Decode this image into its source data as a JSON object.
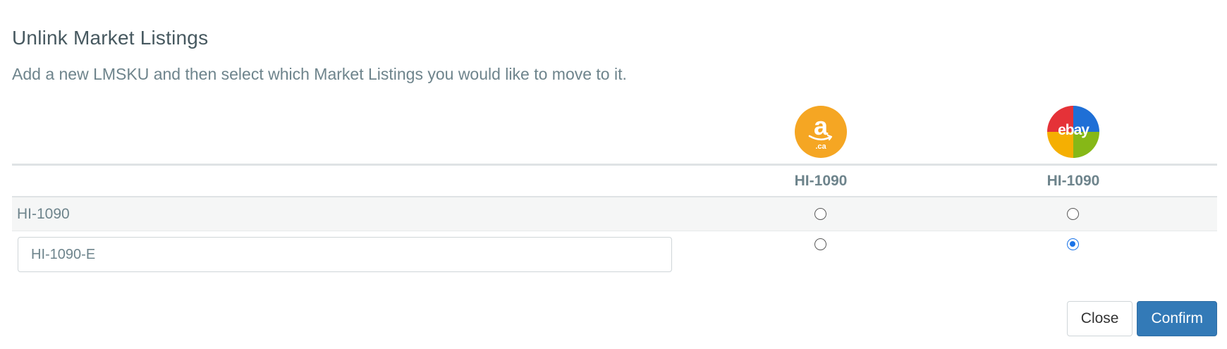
{
  "dialog": {
    "title": "Unlink Market Listings",
    "subtitle": "Add a new LMSKU and then select which Market Listings you would like to move to it."
  },
  "markets": [
    {
      "icon": "amazon-ca-logo-icon",
      "logo_text": "a",
      "logo_subtext": ".ca",
      "color": "#f5a623",
      "sku": "HI-1090"
    },
    {
      "icon": "ebay-logo-icon",
      "logo_text": "ebay",
      "colors": [
        "#e53238",
        "#1f6fd6",
        "#f5af02",
        "#86b817"
      ],
      "sku": "HI-1090"
    }
  ],
  "rows": [
    {
      "lmsku": "HI-1090",
      "selected": [
        false,
        false
      ]
    },
    {
      "new_lmsku_value": "HI-1090-E",
      "selected": [
        false,
        true
      ]
    }
  ],
  "buttons": {
    "close_label": "Close",
    "confirm_label": "Confirm"
  },
  "colors": {
    "primary": "#337ab7",
    "radio_checked": "#1a73e8"
  }
}
